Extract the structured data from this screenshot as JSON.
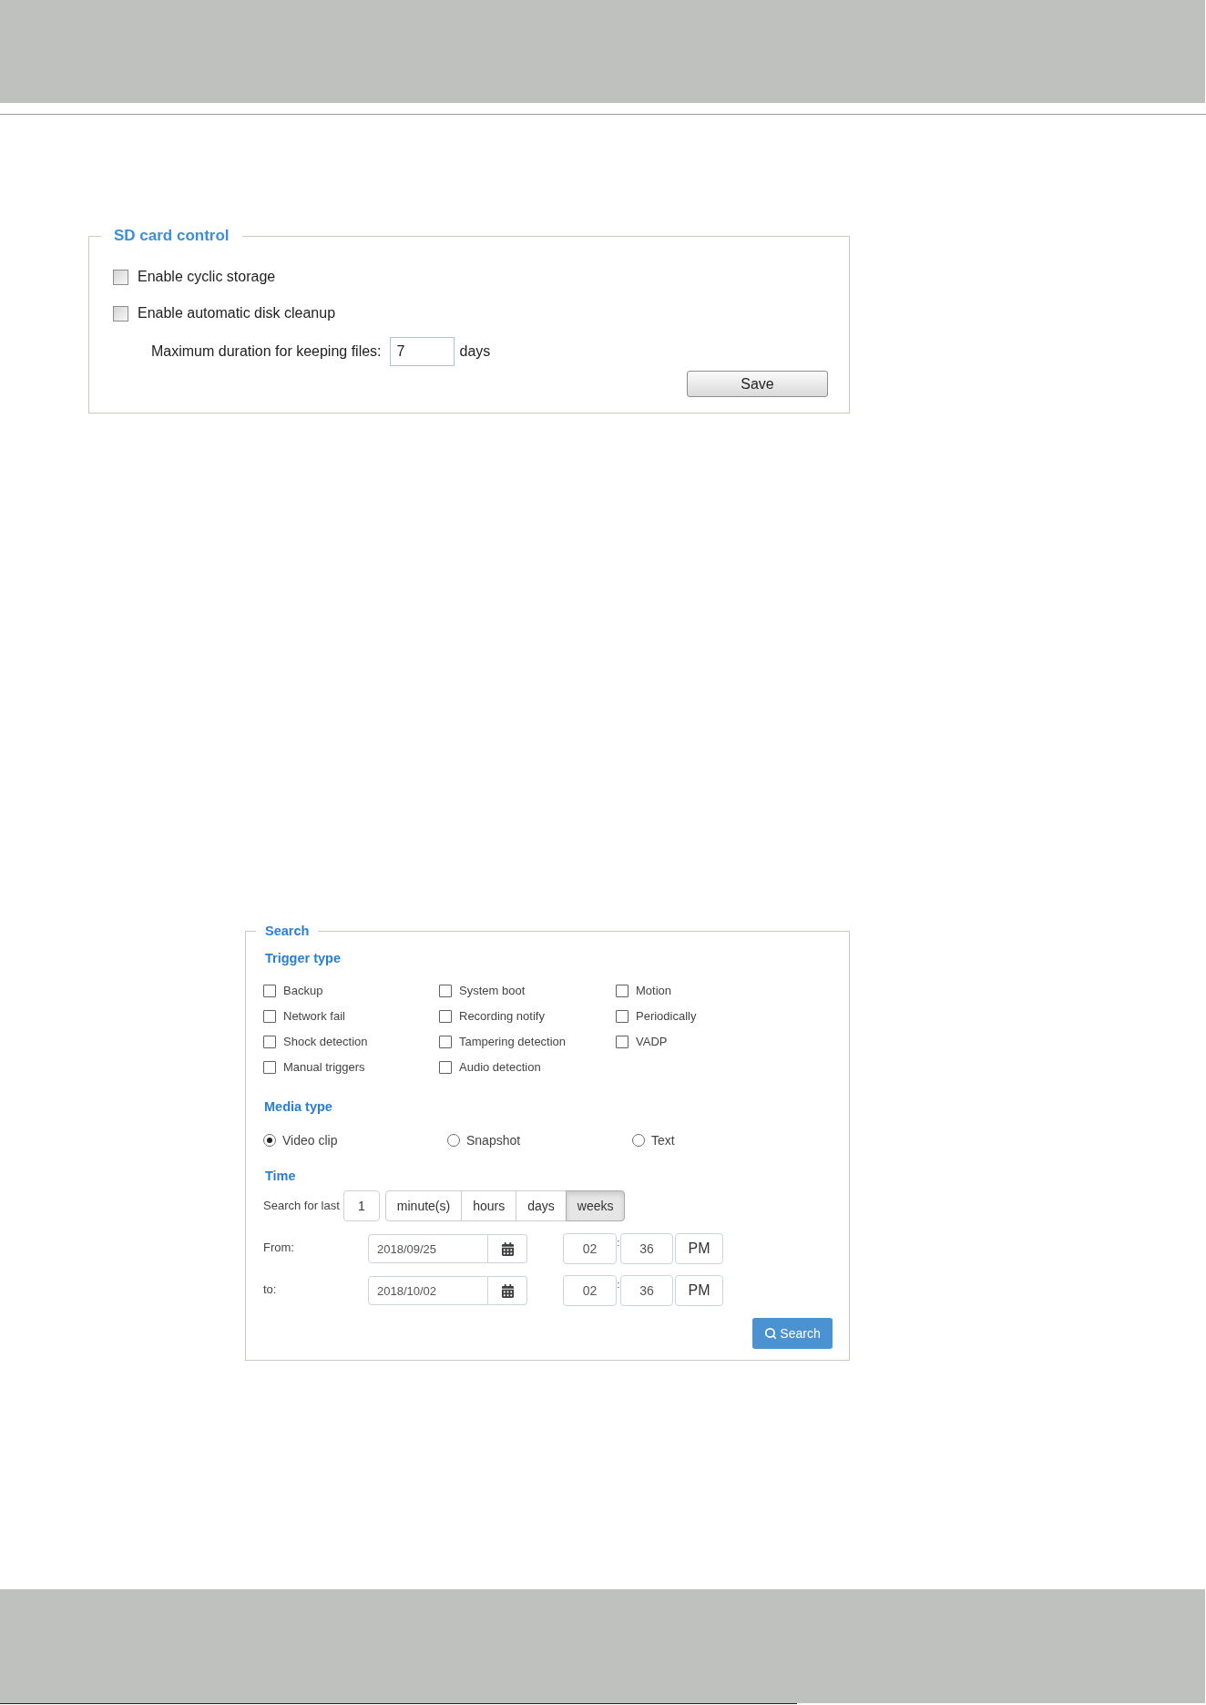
{
  "sd_card_control": {
    "title": "SD card control",
    "options": [
      {
        "label": "Enable cyclic storage",
        "checked": false
      },
      {
        "label": "Enable automatic disk cleanup",
        "checked": false
      }
    ],
    "max_duration": {
      "label": "Maximum duration for keeping files:",
      "value": "7",
      "unit": "days"
    },
    "save_button": "Save"
  },
  "search": {
    "title": "Search",
    "trigger_type": {
      "heading": "Trigger type",
      "options": [
        {
          "label": "Backup",
          "checked": false
        },
        {
          "label": "System boot",
          "checked": false
        },
        {
          "label": "Motion",
          "checked": false
        },
        {
          "label": "Network fail",
          "checked": false
        },
        {
          "label": "Recording notify",
          "checked": false
        },
        {
          "label": "Periodically",
          "checked": false
        },
        {
          "label": "Shock detection",
          "checked": false
        },
        {
          "label": "Tampering detection",
          "checked": false
        },
        {
          "label": "VADP",
          "checked": false
        },
        {
          "label": "Manual triggers",
          "checked": false
        },
        {
          "label": "Audio detection",
          "checked": false
        }
      ]
    },
    "media_type": {
      "heading": "Media type",
      "options": [
        {
          "label": "Video clip",
          "selected": true
        },
        {
          "label": "Snapshot",
          "selected": false
        },
        {
          "label": "Text",
          "selected": false
        }
      ]
    },
    "time": {
      "heading": "Time",
      "search_for_last": {
        "label": "Search for last",
        "value": "1",
        "units": [
          {
            "label": "minute(s)",
            "selected": false
          },
          {
            "label": "hours",
            "selected": false
          },
          {
            "label": "days",
            "selected": false
          },
          {
            "label": "weeks",
            "selected": true
          }
        ]
      },
      "range": [
        {
          "label": "From:",
          "date": "2018/09/25",
          "hour": "02",
          "separator": ":",
          "minute": "36",
          "period": "PM"
        },
        {
          "label": "to:",
          "date": "2018/10/02",
          "hour": "02",
          "separator": ":",
          "minute": "36",
          "period": "PM"
        }
      ]
    },
    "search_button": "Search"
  }
}
